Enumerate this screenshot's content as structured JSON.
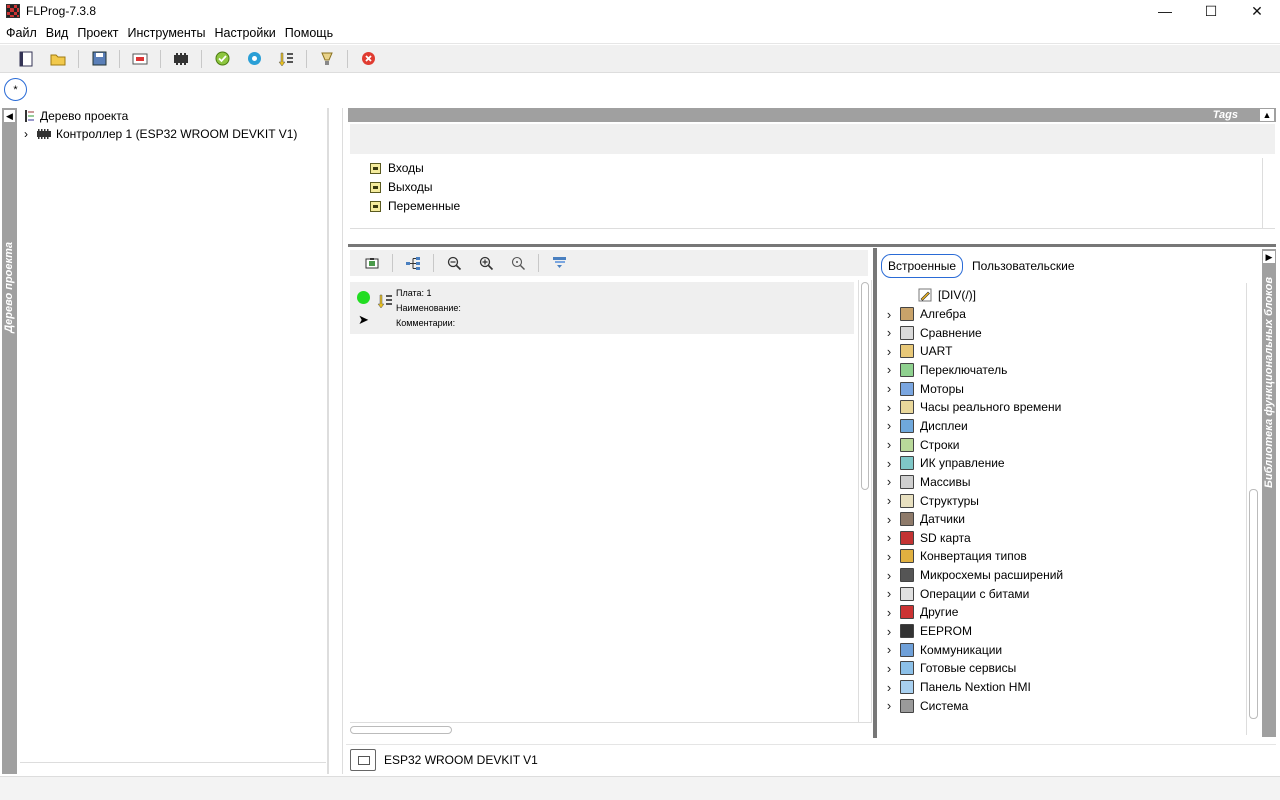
{
  "window": {
    "title": "FLProg-7.3.8",
    "minimize": "—",
    "maximize": "☐",
    "close": "✕"
  },
  "menu": [
    "Файл",
    "Вид",
    "Проект",
    "Инструменты",
    "Настройки",
    "Помощь"
  ],
  "toolbar": {
    "icons": [
      "new-project-icon",
      "open-folder-icon",
      "save-icon",
      "board-icon",
      "controller-icon",
      "check-icon",
      "eye-icon",
      "upload-icon",
      "lamp-icon",
      "stop-icon"
    ]
  },
  "project_tab": {
    "label": "*"
  },
  "project_tree": {
    "strip_label": "Дерево проекта",
    "root": "Дерево проекта",
    "controller": "Контроллер 1 (ESP32 WROOM DEVKIT V1)"
  },
  "tags": {
    "title": "Tags",
    "items": [
      "Входы",
      "Выходы",
      "Переменные"
    ]
  },
  "schema": {
    "board_label": "Плата: 1",
    "name_label": "Наименование:",
    "comment_label": "Комментарии:"
  },
  "library": {
    "strip_label": "Библиотека функциональных блоков",
    "tabs": {
      "builtin": "Встроенные",
      "custom": "Пользовательские"
    },
    "first_item": "[DIV(/)]",
    "categories": [
      "Алгебра",
      "Сравнение",
      "UART",
      "Переключатель",
      "Моторы",
      "Часы реального времени",
      "Дисплеи",
      "Строки",
      "ИК управление",
      "Массивы",
      "Структуры",
      "Датчики",
      "SD карта",
      "Конвертация типов",
      "Микросхемы расширений",
      "Операции с битами",
      "Другие",
      "EEPROM",
      "Коммуникации",
      "Готовые сервисы",
      "Панель Nextion HMI",
      "Система"
    ],
    "category_colors": [
      "#c9a36a",
      "#d9d9d9",
      "#e8c878",
      "#8fd18f",
      "#7aa6e0",
      "#e9d79a",
      "#6fa8dc",
      "#b9d99a",
      "#7fc7c7",
      "#cfcfcf",
      "#e8e0c0",
      "#8e7a6a",
      "#c33333",
      "#e0b040",
      "#555555",
      "#e0e0e0",
      "#cc3333",
      "#333333",
      "#6fa0d8",
      "#8cc0e8",
      "#a8d0f0",
      "#9a9a9a"
    ]
  },
  "status": {
    "board": "ESP32 WROOM DEVKIT V1"
  }
}
